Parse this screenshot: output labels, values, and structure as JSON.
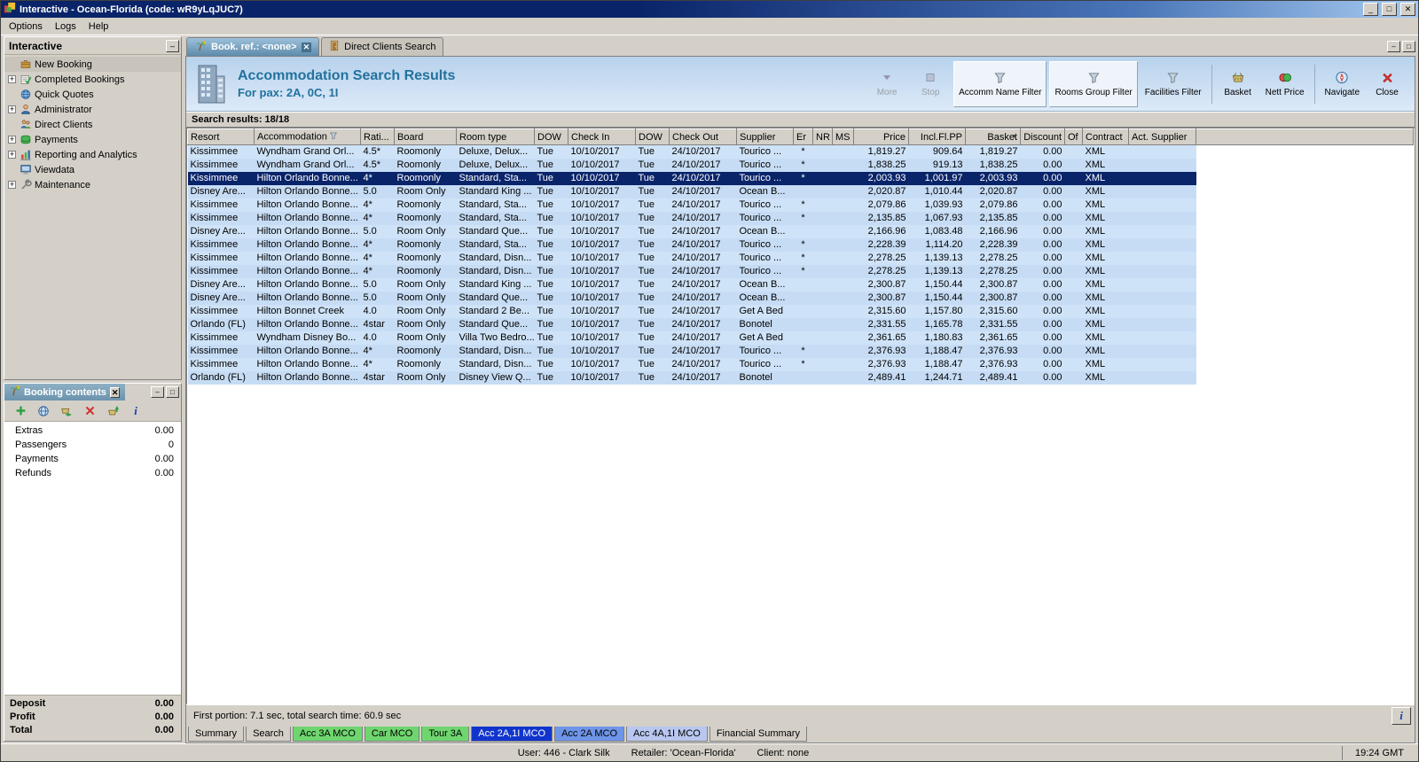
{
  "window": {
    "title": "Interactive - Ocean-Florida (code: wR9yLqJUC7)"
  },
  "menu": {
    "items": [
      "Options",
      "Logs",
      "Help"
    ]
  },
  "sidebar": {
    "title": "Interactive",
    "items": [
      {
        "label": "New Booking",
        "icon": "briefcase",
        "expandable": false,
        "selected": true
      },
      {
        "label": "Completed Bookings",
        "icon": "completed",
        "expandable": true,
        "selected": false
      },
      {
        "label": "Quick Quotes",
        "icon": "globe",
        "expandable": false,
        "selected": false
      },
      {
        "label": "Administrator",
        "icon": "admin",
        "expandable": true,
        "selected": false
      },
      {
        "label": "Direct Clients",
        "icon": "clients",
        "expandable": false,
        "selected": false
      },
      {
        "label": "Payments",
        "icon": "payments",
        "expandable": true,
        "selected": false
      },
      {
        "label": "Reporting and Analytics",
        "icon": "chart",
        "expandable": true,
        "selected": false
      },
      {
        "label": "Viewdata",
        "icon": "monitor",
        "expandable": false,
        "selected": false
      },
      {
        "label": "Maintenance",
        "icon": "wrench",
        "expandable": true,
        "selected": false
      }
    ]
  },
  "booking_contents": {
    "title": "Booking contents",
    "toolbar": [
      "add",
      "globe2",
      "basket-out",
      "delete",
      "basket-in",
      "info"
    ],
    "rows": [
      {
        "label": "Extras",
        "value": "0.00"
      },
      {
        "label": "Passengers",
        "value": "0"
      },
      {
        "label": "Payments",
        "value": "0.00"
      },
      {
        "label": "Refunds",
        "value": "0.00"
      }
    ],
    "totals": [
      {
        "label": "Deposit",
        "value": "0.00"
      },
      {
        "label": "Profit",
        "value": "0.00"
      },
      {
        "label": "Total",
        "value": "0.00"
      }
    ]
  },
  "main": {
    "tabs": [
      {
        "label": "Book. ref.: <none>",
        "icon": "palm",
        "active": true,
        "closable": true
      },
      {
        "label": "Direct Clients Search",
        "icon": "door",
        "active": false,
        "closable": false
      }
    ],
    "header": {
      "title": "Accommodation Search Results",
      "subtitle": "For pax: 2A, 0C, 1I"
    },
    "toolbar": [
      {
        "label": "More",
        "icon": "more",
        "disabled": true
      },
      {
        "label": "Stop",
        "icon": "stop",
        "disabled": true
      },
      {
        "label": "Accomm Name Filter",
        "icon": "funnel",
        "boxed": true
      },
      {
        "label": "Rooms Group Filter",
        "icon": "funnel",
        "boxed": true
      },
      {
        "label": "Facilities Filter",
        "icon": "funnel"
      },
      {
        "type": "sep"
      },
      {
        "label": "Basket",
        "icon": "basket"
      },
      {
        "label": "Nett Price",
        "icon": "coins"
      },
      {
        "type": "sep"
      },
      {
        "label": "Navigate",
        "icon": "navigate"
      },
      {
        "label": "Close",
        "icon": "closex"
      }
    ],
    "results_label": "Search results: 18/18",
    "footer_status": "First portion: 7.1 sec, total search time: 60.9 sec",
    "bottom_tabs": [
      {
        "label": "Summary",
        "style": "plain"
      },
      {
        "label": "Search",
        "style": "plain"
      },
      {
        "label": "Acc 3A MCO",
        "style": "green"
      },
      {
        "label": "Car MCO",
        "style": "green"
      },
      {
        "label": "Tour 3A",
        "style": "green"
      },
      {
        "label": "Acc 2A,1I MCO",
        "style": "selected"
      },
      {
        "label": "Acc 2A MCO",
        "style": "blue"
      },
      {
        "label": "Acc 4A,1I MCO",
        "style": "lightblue"
      },
      {
        "label": "Financial Summary",
        "style": "plain"
      }
    ],
    "table": {
      "columns": [
        "Resort",
        "Accommodation",
        "Rati...",
        "Board",
        "Room type",
        "DOW",
        "Check In",
        "DOW",
        "Check Out",
        "Supplier",
        "Er",
        "NR",
        "MS",
        "Price",
        "Incl.Fl.PP",
        "Basket",
        "Discount",
        "Of",
        "Contract",
        "Act. Supplier"
      ],
      "selected_index": 2,
      "rows": [
        [
          "Kissimmee",
          "Wyndham Grand Orl...",
          "4.5*",
          "Roomonly",
          "Deluxe, Delux...",
          "Tue",
          "10/10/2017",
          "Tue",
          "24/10/2017",
          "Tourico ...",
          "*",
          "",
          "",
          "1,819.27",
          "909.64",
          "1,819.27",
          "0.00",
          "",
          "XML",
          ""
        ],
        [
          "Kissimmee",
          "Wyndham Grand Orl...",
          "4.5*",
          "Roomonly",
          "Deluxe, Delux...",
          "Tue",
          "10/10/2017",
          "Tue",
          "24/10/2017",
          "Tourico ...",
          "*",
          "",
          "",
          "1,838.25",
          "919.13",
          "1,838.25",
          "0.00",
          "",
          "XML",
          ""
        ],
        [
          "Kissimmee",
          "Hilton Orlando Bonne...",
          "4*",
          "Roomonly",
          "Standard, Sta...",
          "Tue",
          "10/10/2017",
          "Tue",
          "24/10/2017",
          "Tourico ...",
          "*",
          "",
          "",
          "2,003.93",
          "1,001.97",
          "2,003.93",
          "0.00",
          "",
          "XML",
          ""
        ],
        [
          "Disney Are...",
          "Hilton Orlando Bonne...",
          "5.0",
          "Room Only",
          "Standard King ...",
          "Tue",
          "10/10/2017",
          "Tue",
          "24/10/2017",
          "Ocean B...",
          "",
          "",
          "",
          "2,020.87",
          "1,010.44",
          "2,020.87",
          "0.00",
          "",
          "XML",
          ""
        ],
        [
          "Kissimmee",
          "Hilton Orlando Bonne...",
          "4*",
          "Roomonly",
          "Standard, Sta...",
          "Tue",
          "10/10/2017",
          "Tue",
          "24/10/2017",
          "Tourico ...",
          "*",
          "",
          "",
          "2,079.86",
          "1,039.93",
          "2,079.86",
          "0.00",
          "",
          "XML",
          ""
        ],
        [
          "Kissimmee",
          "Hilton Orlando Bonne...",
          "4*",
          "Roomonly",
          "Standard, Sta...",
          "Tue",
          "10/10/2017",
          "Tue",
          "24/10/2017",
          "Tourico ...",
          "*",
          "",
          "",
          "2,135.85",
          "1,067.93",
          "2,135.85",
          "0.00",
          "",
          "XML",
          ""
        ],
        [
          "Disney Are...",
          "Hilton Orlando Bonne...",
          "5.0",
          "Room Only",
          "Standard Que...",
          "Tue",
          "10/10/2017",
          "Tue",
          "24/10/2017",
          "Ocean B...",
          "",
          "",
          "",
          "2,166.96",
          "1,083.48",
          "2,166.96",
          "0.00",
          "",
          "XML",
          ""
        ],
        [
          "Kissimmee",
          "Hilton Orlando Bonne...",
          "4*",
          "Roomonly",
          "Standard, Sta...",
          "Tue",
          "10/10/2017",
          "Tue",
          "24/10/2017",
          "Tourico ...",
          "*",
          "",
          "",
          "2,228.39",
          "1,114.20",
          "2,228.39",
          "0.00",
          "",
          "XML",
          ""
        ],
        [
          "Kissimmee",
          "Hilton Orlando Bonne...",
          "4*",
          "Roomonly",
          "Standard, Disn...",
          "Tue",
          "10/10/2017",
          "Tue",
          "24/10/2017",
          "Tourico ...",
          "*",
          "",
          "",
          "2,278.25",
          "1,139.13",
          "2,278.25",
          "0.00",
          "",
          "XML",
          ""
        ],
        [
          "Kissimmee",
          "Hilton Orlando Bonne...",
          "4*",
          "Roomonly",
          "Standard, Disn...",
          "Tue",
          "10/10/2017",
          "Tue",
          "24/10/2017",
          "Tourico ...",
          "*",
          "",
          "",
          "2,278.25",
          "1,139.13",
          "2,278.25",
          "0.00",
          "",
          "XML",
          ""
        ],
        [
          "Disney Are...",
          "Hilton Orlando Bonne...",
          "5.0",
          "Room Only",
          "Standard King ...",
          "Tue",
          "10/10/2017",
          "Tue",
          "24/10/2017",
          "Ocean B...",
          "",
          "",
          "",
          "2,300.87",
          "1,150.44",
          "2,300.87",
          "0.00",
          "",
          "XML",
          ""
        ],
        [
          "Disney Are...",
          "Hilton Orlando Bonne...",
          "5.0",
          "Room Only",
          "Standard Que...",
          "Tue",
          "10/10/2017",
          "Tue",
          "24/10/2017",
          "Ocean B...",
          "",
          "",
          "",
          "2,300.87",
          "1,150.44",
          "2,300.87",
          "0.00",
          "",
          "XML",
          ""
        ],
        [
          "Kissimmee",
          "Hilton Bonnet Creek",
          "4.0",
          "Room Only",
          "Standard 2 Be...",
          "Tue",
          "10/10/2017",
          "Tue",
          "24/10/2017",
          "Get A Bed",
          "",
          "",
          "",
          "2,315.60",
          "1,157.80",
          "2,315.60",
          "0.00",
          "",
          "XML",
          ""
        ],
        [
          "Orlando (FL)",
          "Hilton Orlando Bonne...",
          "4star",
          "Room Only",
          "Standard Que...",
          "Tue",
          "10/10/2017",
          "Tue",
          "24/10/2017",
          "Bonotel",
          "",
          "",
          "",
          "2,331.55",
          "1,165.78",
          "2,331.55",
          "0.00",
          "",
          "XML",
          ""
        ],
        [
          "Kissimmee",
          "Wyndham Disney Bo...",
          "4.0",
          "Room Only",
          "Villa Two Bedro...",
          "Tue",
          "10/10/2017",
          "Tue",
          "24/10/2017",
          "Get A Bed",
          "",
          "",
          "",
          "2,361.65",
          "1,180.83",
          "2,361.65",
          "0.00",
          "",
          "XML",
          ""
        ],
        [
          "Kissimmee",
          "Hilton Orlando Bonne...",
          "4*",
          "Roomonly",
          "Standard, Disn...",
          "Tue",
          "10/10/2017",
          "Tue",
          "24/10/2017",
          "Tourico ...",
          "*",
          "",
          "",
          "2,376.93",
          "1,188.47",
          "2,376.93",
          "0.00",
          "",
          "XML",
          ""
        ],
        [
          "Kissimmee",
          "Hilton Orlando Bonne...",
          "4*",
          "Roomonly",
          "Standard, Disn...",
          "Tue",
          "10/10/2017",
          "Tue",
          "24/10/2017",
          "Tourico ...",
          "*",
          "",
          "",
          "2,376.93",
          "1,188.47",
          "2,376.93",
          "0.00",
          "",
          "XML",
          ""
        ],
        [
          "Orlando (FL)",
          "Hilton Orlando Bonne...",
          "4star",
          "Room Only",
          "Disney View Q...",
          "Tue",
          "10/10/2017",
          "Tue",
          "24/10/2017",
          "Bonotel",
          "",
          "",
          "",
          "2,489.41",
          "1,244.71",
          "2,489.41",
          "0.00",
          "",
          "XML",
          ""
        ]
      ]
    }
  },
  "statusbar": {
    "user": "User: 446 - Clark Silk",
    "retailer": "Retailer: 'Ocean-Florida'",
    "client": "Client: none",
    "clock": "19:24 GMT"
  },
  "colors": {
    "selection": "#0a246a",
    "row_blue": "#cfe3f8",
    "titlebar": "#0a246a",
    "header_text": "#23729e",
    "tab_green": "#6fd66f",
    "tab_selected_blue": "#1135cc",
    "tab_blue": "#6e95e8",
    "tab_lightblue": "#b9c7f0"
  }
}
